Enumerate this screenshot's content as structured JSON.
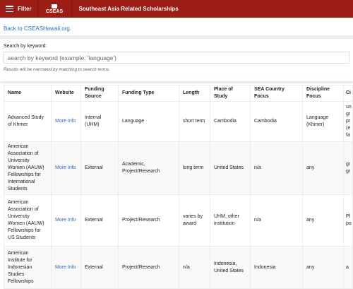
{
  "header": {
    "menu_label": "Filter",
    "logo_text": "CSEAS",
    "title": "Southeast Asia Related Scholarships",
    "color": "#9c1d15"
  },
  "back_link": "Back to CSEASHawaii.org.",
  "search": {
    "label": "Search by keyword:",
    "placeholder": "search by keyword (example: 'language')",
    "hint": "Results will be narrowed by matching to search terms."
  },
  "table": {
    "columns": [
      "Name",
      "Website",
      "Funding Source",
      "Funding Type",
      "Length",
      "Place of Study",
      "SEA Country Focus",
      "Discipline Focus",
      "Ci"
    ],
    "rows": [
      [
        "Advanced Study of Khmer",
        "More Info",
        "Internal (UHM)",
        "Language",
        "short term",
        "Cambodia",
        "Cambodia",
        "Language (Khmer)",
        "un gr pr (e fa"
      ],
      [
        "American Association of University Women (AAUW) Fellowships for International Students",
        "More Info",
        "External",
        "Academic, Project/Research",
        "long term",
        "United States",
        "n/a",
        "any",
        "gr gr"
      ],
      [
        "American Association of University Women (AAUW) Fellowships for US Students",
        "More Info",
        "External",
        "Project/Research",
        "varies by award",
        "UHM, other institution",
        "n/a",
        "any",
        "Pl po"
      ],
      [
        "American Institute for Indonesian Studies Fellowships",
        "More Info",
        "External",
        "Project/Research",
        "n/a",
        "Indonesia, United States",
        "Indonesia",
        "any",
        "a"
      ]
    ]
  }
}
